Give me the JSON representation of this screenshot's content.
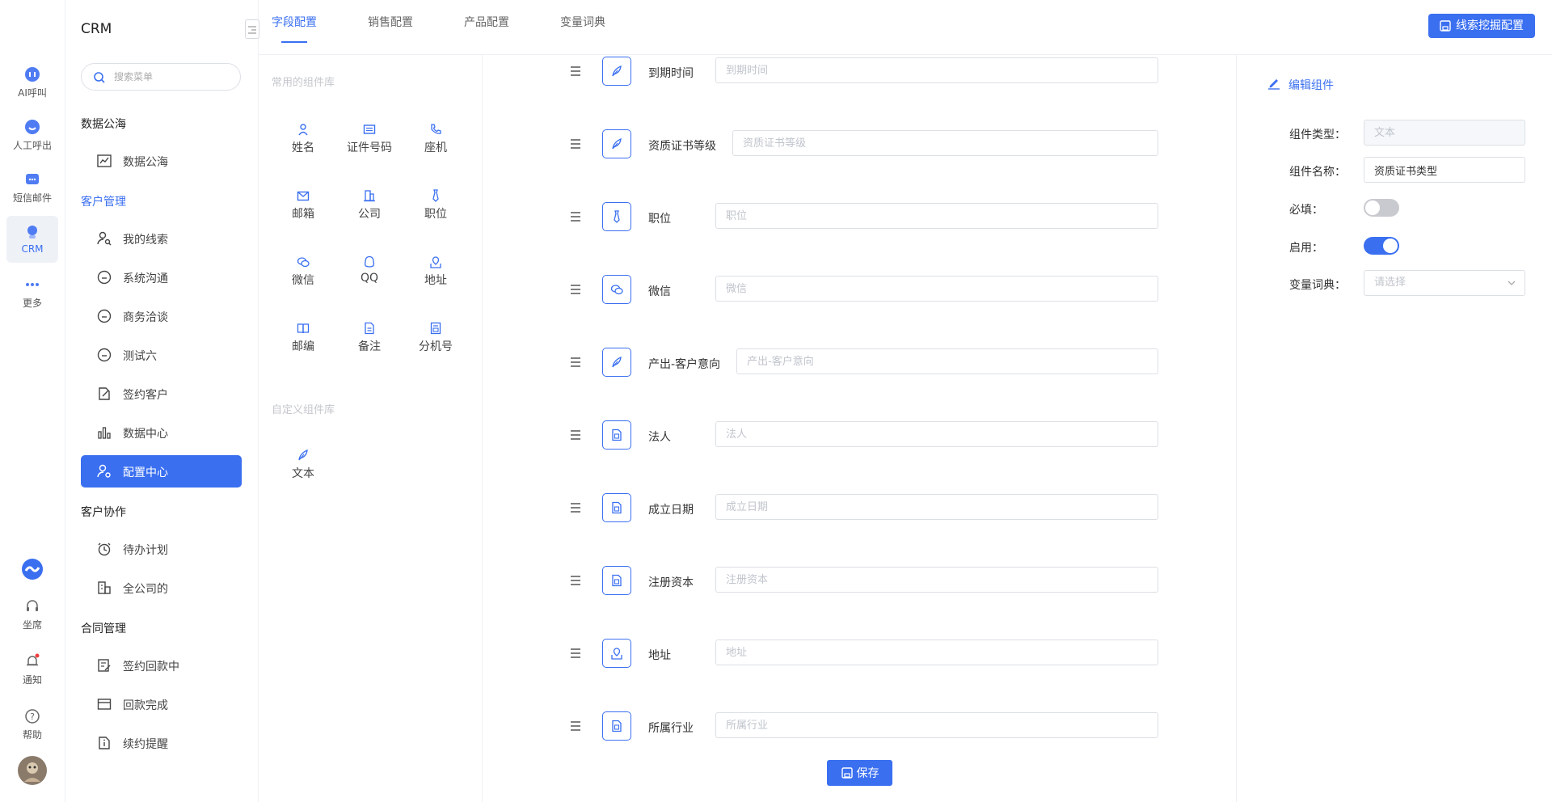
{
  "app": {
    "title": "CRM"
  },
  "rail": {
    "items": [
      {
        "label": "AI呼叫",
        "icon": "ai-call-icon"
      },
      {
        "label": "人工呼出",
        "icon": "manual-call-icon"
      },
      {
        "label": "短信邮件",
        "icon": "sms-mail-icon"
      },
      {
        "label": "CRM",
        "icon": "crm-icon",
        "active": true
      },
      {
        "label": "更多",
        "icon": "more-icon"
      }
    ],
    "bottom": [
      {
        "label": "坐席",
        "icon": "headset-icon"
      },
      {
        "label": "通知",
        "icon": "bell-icon"
      },
      {
        "label": "帮助",
        "icon": "help-icon"
      }
    ]
  },
  "sidebar": {
    "search_placeholder": "搜索菜单",
    "groups": [
      {
        "title": "数据公海",
        "items": [
          "数据公海"
        ]
      },
      {
        "title": "客户管理",
        "items": [
          "我的线索",
          "系统沟通",
          "商务洽谈",
          "测试六",
          "签约客户",
          "数据中心",
          "配置中心"
        ]
      },
      {
        "title": "客户协作",
        "items": [
          "待办计划",
          "全公司的"
        ]
      },
      {
        "title": "合同管理",
        "items": [
          "签约回款中",
          "回款完成",
          "续约提醒"
        ]
      }
    ],
    "active_item": "配置中心"
  },
  "tabs": {
    "items": [
      "字段配置",
      "销售配置",
      "产品配置",
      "变量词典"
    ],
    "active": "字段配置",
    "action_button": "线索挖掘配置"
  },
  "library": {
    "common_title": "常用的组件库",
    "common": [
      {
        "label": "姓名",
        "icon": "person-icon"
      },
      {
        "label": "证件号码",
        "icon": "id-card-icon"
      },
      {
        "label": "座机",
        "icon": "phone-icon"
      },
      {
        "label": "邮箱",
        "icon": "mail-icon"
      },
      {
        "label": "公司",
        "icon": "building-icon"
      },
      {
        "label": "职位",
        "icon": "tie-icon"
      },
      {
        "label": "微信",
        "icon": "wechat-icon"
      },
      {
        "label": "QQ",
        "icon": "qq-icon"
      },
      {
        "label": "地址",
        "icon": "map-icon"
      },
      {
        "label": "邮编",
        "icon": "postcode-icon"
      },
      {
        "label": "备注",
        "icon": "note-icon"
      },
      {
        "label": "分机号",
        "icon": "extension-icon"
      }
    ],
    "custom_title": "自定义组件库",
    "custom": [
      {
        "label": "文本",
        "icon": "feather-icon"
      }
    ]
  },
  "canvas": {
    "fields": [
      {
        "label": "到期时间",
        "placeholder": "到期时间",
        "icon": "feather-icon"
      },
      {
        "label": "资质证书等级",
        "placeholder": "资质证书等级",
        "icon": "feather-icon"
      },
      {
        "label": "职位",
        "placeholder": "职位",
        "icon": "tie-icon"
      },
      {
        "label": "微信",
        "placeholder": "微信",
        "icon": "wechat-icon"
      },
      {
        "label": "产出-客户意向",
        "placeholder": "产出-客户意向",
        "icon": "feather-icon"
      },
      {
        "label": "法人",
        "placeholder": "法人",
        "icon": "doc-icon"
      },
      {
        "label": "成立日期",
        "placeholder": "成立日期",
        "icon": "doc-icon"
      },
      {
        "label": "注册资本",
        "placeholder": "注册资本",
        "icon": "doc-icon"
      },
      {
        "label": "地址",
        "placeholder": "地址",
        "icon": "map-icon"
      },
      {
        "label": "所属行业",
        "placeholder": "所属行业",
        "icon": "doc-icon"
      }
    ],
    "save_label": "保存"
  },
  "edit": {
    "title": "编辑组件",
    "type_label": "组件类型：",
    "type_value": "文本",
    "name_label": "组件名称：",
    "name_value": "资质证书类型",
    "required_label": "必填：",
    "required": false,
    "enabled_label": "启用：",
    "enabled": true,
    "dict_label": "变量词典：",
    "dict_placeholder": "请选择"
  },
  "colors": {
    "accent": "#3a6ff0",
    "border": "#dcdfe4",
    "muted": "#c0c4cc"
  }
}
